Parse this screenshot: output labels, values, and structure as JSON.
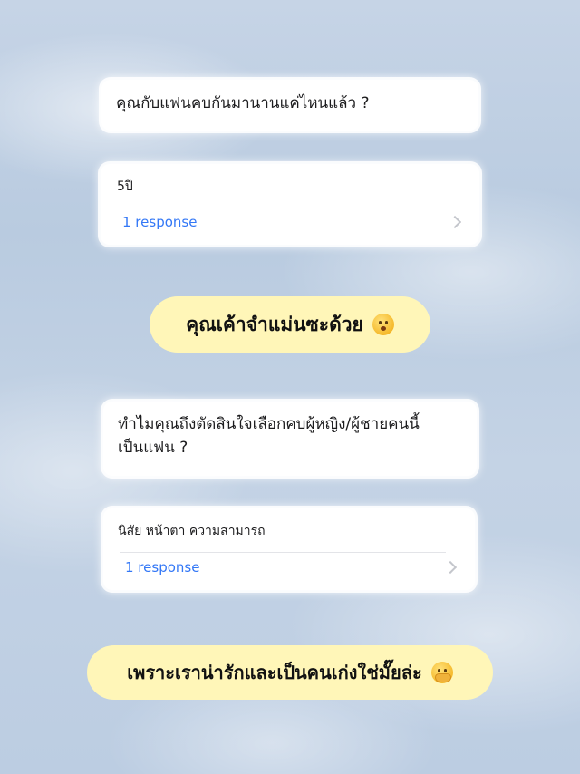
{
  "card1": {
    "question": "คุณกับแฟนคบกันมานานแค่ไหนแล้ว ?"
  },
  "card2": {
    "answer": "5ปี",
    "response_label": "1 response"
  },
  "pill1": {
    "text": "คุณเค้าจำแม่นซะด้วย",
    "emoji": "kissing-face-icon"
  },
  "card3": {
    "question": "ทำไมคุณถึงตัดสินใจเลือกคบผู้หญิง/ผู้ชายคนนี้ เป็นแฟน ?"
  },
  "card4": {
    "answer": "นิสัย หน้าตา ความสามารถ",
    "response_label": "1 response"
  },
  "pill2": {
    "text": "เพราะเราน่ารักและเป็นคนเก่งใช่มั๊ยล่ะ",
    "emoji": "face-with-hand-over-mouth-icon"
  },
  "colors": {
    "link": "#3478f6",
    "pill": "#fff6b8",
    "card": "#ffffff"
  }
}
